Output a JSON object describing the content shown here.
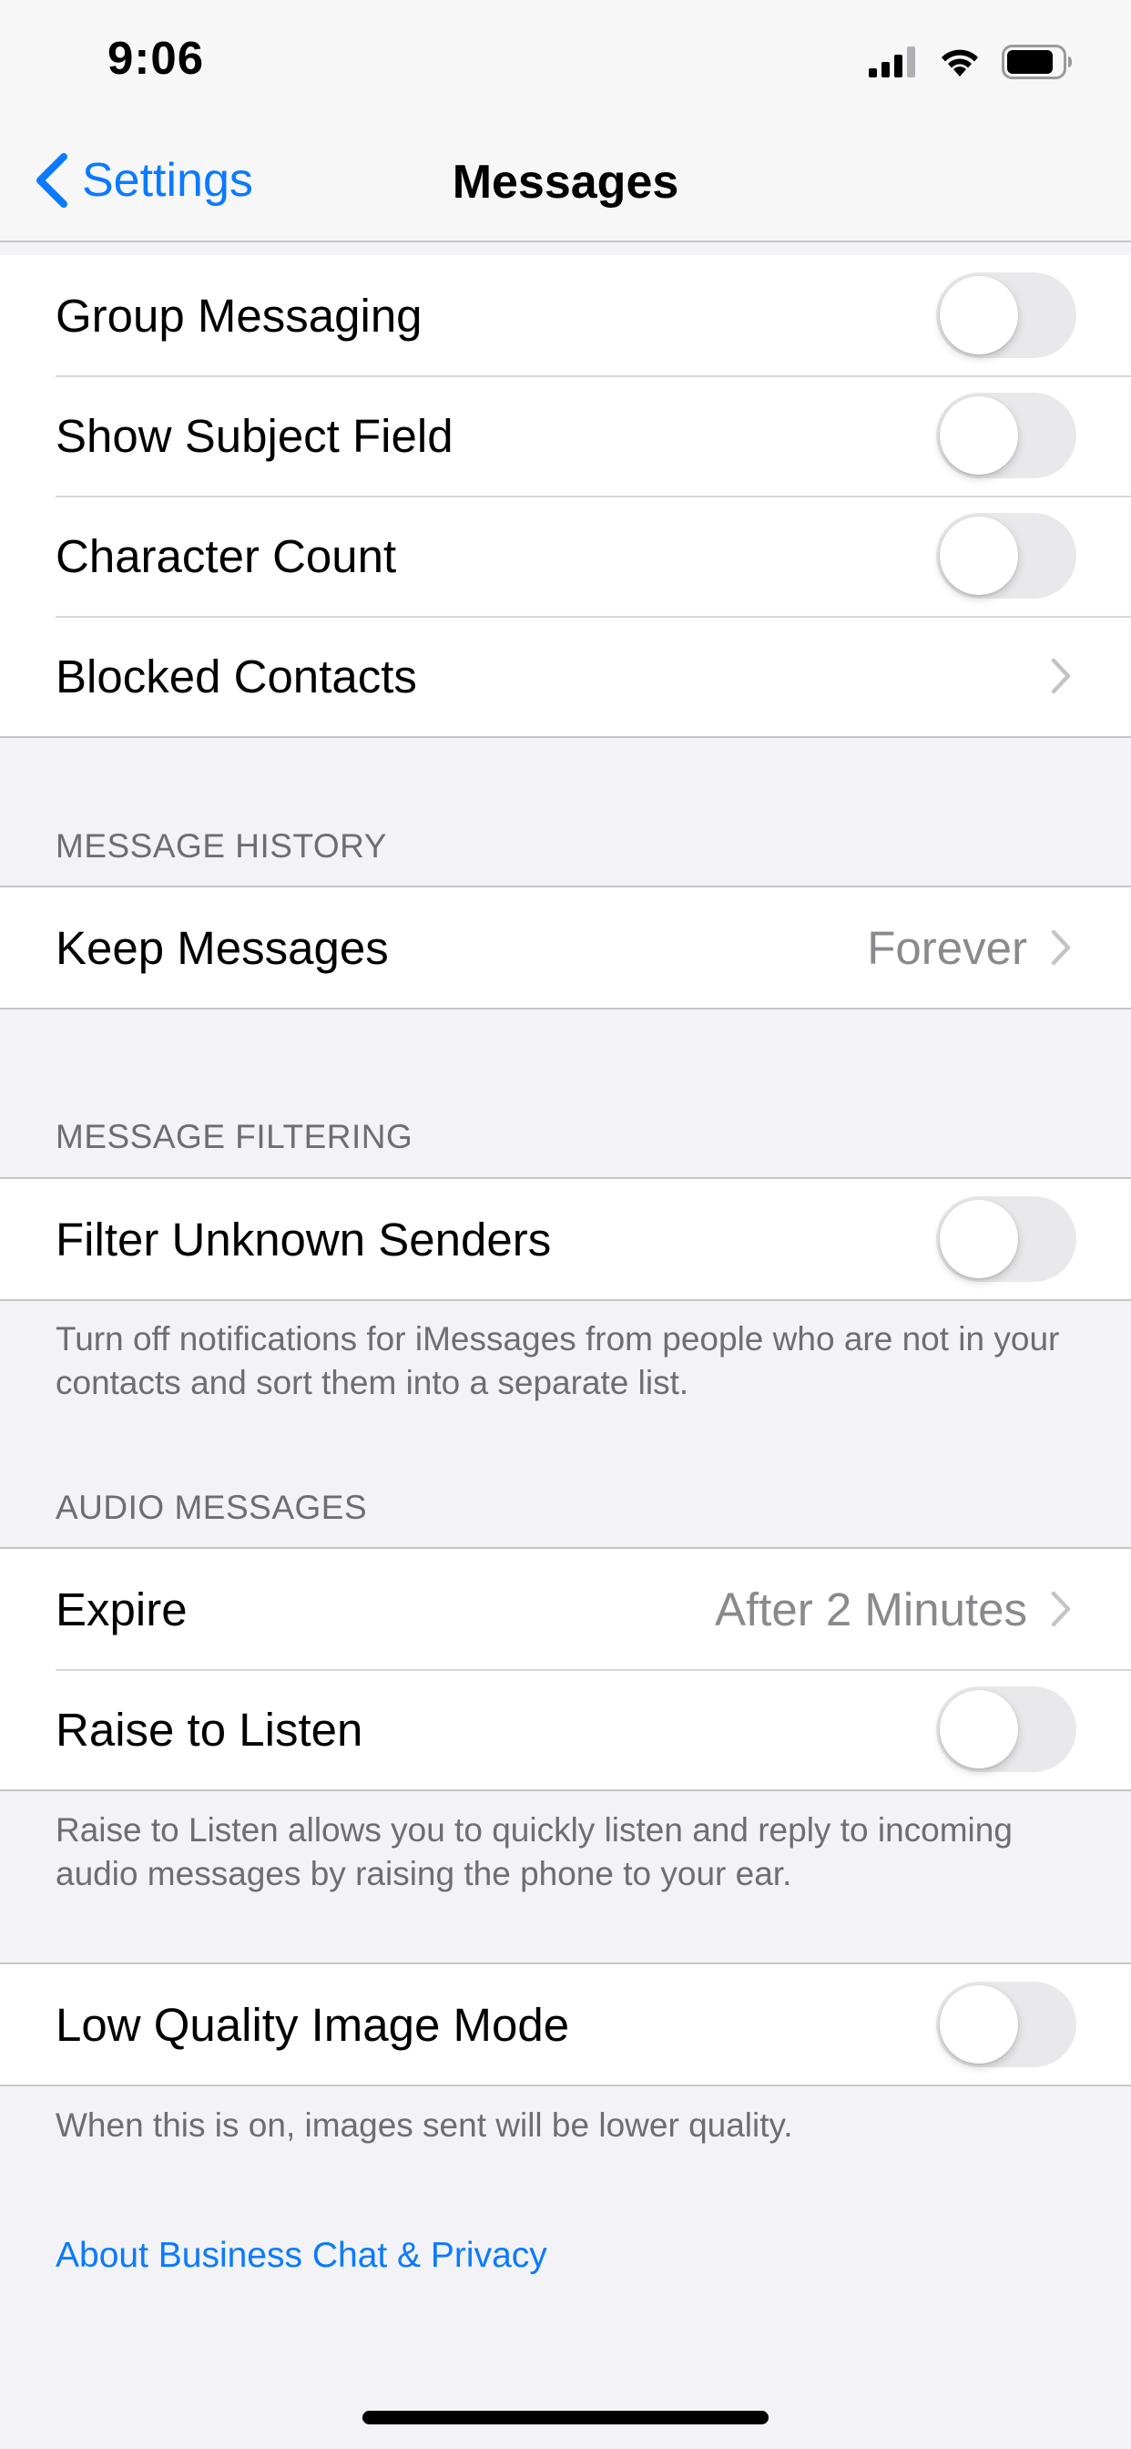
{
  "status_bar": {
    "time": "9:06",
    "icons": [
      "cellular-signal-icon",
      "wifi-icon",
      "battery-icon"
    ]
  },
  "nav": {
    "back_label": "Settings",
    "title": "Messages"
  },
  "colors": {
    "accent": "#0a7aff",
    "background": "#f2f2f7",
    "secondary_text": "#8a8a8e",
    "toggle_off": "#e9e9eb"
  },
  "general": {
    "rows": [
      {
        "label": "Group Messaging",
        "toggle_on": false
      },
      {
        "label": "Show Subject Field",
        "toggle_on": false
      },
      {
        "label": "Character Count",
        "toggle_on": false
      },
      {
        "label": "Blocked Contacts"
      }
    ]
  },
  "message_history": {
    "header": "MESSAGE HISTORY",
    "keep_messages": {
      "label": "Keep Messages",
      "value": "Forever"
    }
  },
  "message_filtering": {
    "header": "MESSAGE FILTERING",
    "filter_unknown": {
      "label": "Filter Unknown Senders",
      "toggle_on": false
    },
    "footer": "Turn off notifications for iMessages from people who are not in your contacts and sort them into a separate list."
  },
  "audio_messages": {
    "header": "AUDIO MESSAGES",
    "expire": {
      "label": "Expire",
      "value": "After 2 Minutes"
    },
    "raise_to_listen": {
      "label": "Raise to Listen",
      "toggle_on": false
    },
    "footer": "Raise to Listen allows you to quickly listen and reply to incoming audio messages by raising the phone to your ear."
  },
  "low_quality": {
    "label": "Low Quality Image Mode",
    "toggle_on": false,
    "footer": "When this is on, images sent will be lower quality."
  },
  "links": {
    "business_chat": "About Business Chat & Privacy"
  }
}
